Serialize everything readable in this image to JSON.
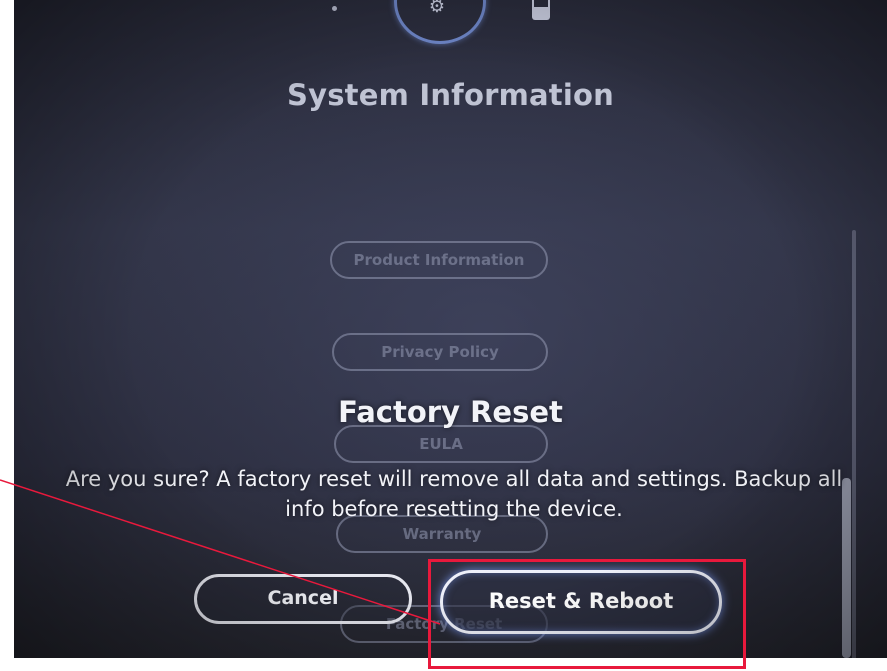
{
  "screen": {
    "title": "System Information"
  },
  "menu": {
    "items": [
      {
        "label": "Product Information"
      },
      {
        "label": "Privacy Policy"
      },
      {
        "label": "EULA"
      },
      {
        "label": "Warranty"
      },
      {
        "label": "Factory Reset"
      }
    ]
  },
  "dialog": {
    "title": "Factory Reset",
    "message": "Are you sure? A factory reset will remove all data and settings. Backup all info before resetting the device.",
    "cancel_label": "Cancel",
    "confirm_label": "Reset & Reboot"
  },
  "colors": {
    "background": "#2d2f41",
    "accent_glow": "#7896f0",
    "annotation": "#e8193c"
  },
  "icons": {
    "top": [
      "dot-icon",
      "gear-icon",
      "battery-icon"
    ]
  }
}
